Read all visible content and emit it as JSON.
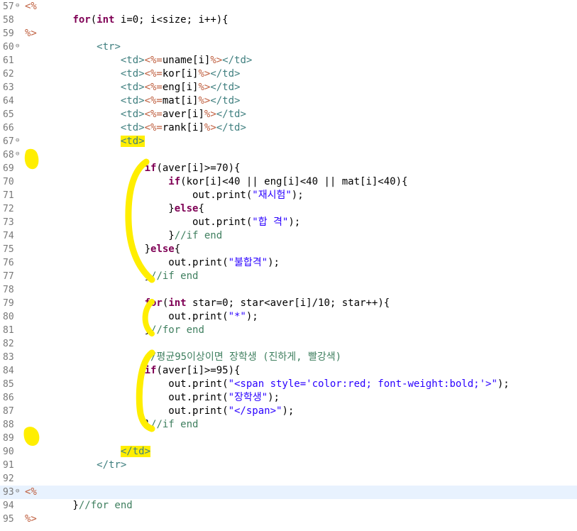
{
  "editor": {
    "lines": [
      {
        "num": "57",
        "fold": "⊖",
        "segs": [
          {
            "t": "<%",
            "c": "scr"
          }
        ]
      },
      {
        "num": "58",
        "segs": [
          {
            "t": "        "
          },
          {
            "t": "for",
            "c": "kw"
          },
          {
            "t": "("
          },
          {
            "t": "int",
            "c": "kw"
          },
          {
            "t": " i=0; i<size; i++){"
          }
        ]
      },
      {
        "num": "59",
        "segs": [
          {
            "t": "%>",
            "c": "scr"
          }
        ]
      },
      {
        "num": "60",
        "fold": "⊖",
        "segs": [
          {
            "t": "            "
          },
          {
            "t": "<tr>",
            "c": "tag"
          }
        ]
      },
      {
        "num": "61",
        "segs": [
          {
            "t": "                "
          },
          {
            "t": "<td>",
            "c": "tag"
          },
          {
            "t": "<%=",
            "c": "scr"
          },
          {
            "t": "uname[i]"
          },
          {
            "t": "%>",
            "c": "scr"
          },
          {
            "t": "</td>",
            "c": "tag"
          }
        ]
      },
      {
        "num": "62",
        "segs": [
          {
            "t": "                "
          },
          {
            "t": "<td>",
            "c": "tag"
          },
          {
            "t": "<%=",
            "c": "scr"
          },
          {
            "t": "kor[i]"
          },
          {
            "t": "%>",
            "c": "scr"
          },
          {
            "t": "</td>",
            "c": "tag"
          }
        ]
      },
      {
        "num": "63",
        "segs": [
          {
            "t": "                "
          },
          {
            "t": "<td>",
            "c": "tag"
          },
          {
            "t": "<%=",
            "c": "scr"
          },
          {
            "t": "eng[i]"
          },
          {
            "t": "%>",
            "c": "scr"
          },
          {
            "t": "</td>",
            "c": "tag"
          }
        ]
      },
      {
        "num": "64",
        "segs": [
          {
            "t": "                "
          },
          {
            "t": "<td>",
            "c": "tag"
          },
          {
            "t": "<%=",
            "c": "scr"
          },
          {
            "t": "mat[i]"
          },
          {
            "t": "%>",
            "c": "scr"
          },
          {
            "t": "</td>",
            "c": "tag"
          }
        ]
      },
      {
        "num": "65",
        "segs": [
          {
            "t": "                "
          },
          {
            "t": "<td>",
            "c": "tag"
          },
          {
            "t": "<%=",
            "c": "scr"
          },
          {
            "t": "aver[i]"
          },
          {
            "t": "%>",
            "c": "scr"
          },
          {
            "t": "</td>",
            "c": "tag"
          }
        ]
      },
      {
        "num": "66",
        "segs": [
          {
            "t": "                "
          },
          {
            "t": "<td>",
            "c": "tag"
          },
          {
            "t": "<%=",
            "c": "scr"
          },
          {
            "t": "rank[i]"
          },
          {
            "t": "%>",
            "c": "scr"
          },
          {
            "t": "</td>",
            "c": "tag"
          }
        ]
      },
      {
        "num": "67",
        "fold": "⊖",
        "segs": [
          {
            "t": "                "
          },
          {
            "t": "<td>",
            "c": "tag hl"
          }
        ]
      },
      {
        "num": "68",
        "fold": "⊖",
        "segs": [
          {
            "t": "<%",
            "c": "scr"
          }
        ]
      },
      {
        "num": "69",
        "segs": [
          {
            "t": "                    "
          },
          {
            "t": "if",
            "c": "kw"
          },
          {
            "t": "(aver[i]>=70){"
          }
        ]
      },
      {
        "num": "70",
        "segs": [
          {
            "t": "                        "
          },
          {
            "t": "if",
            "c": "kw"
          },
          {
            "t": "(kor[i]<40 || eng[i]<40 || mat[i]<40){"
          }
        ]
      },
      {
        "num": "71",
        "segs": [
          {
            "t": "                            out.print("
          },
          {
            "t": "\"재시험\"",
            "c": "str"
          },
          {
            "t": ");"
          }
        ]
      },
      {
        "num": "72",
        "segs": [
          {
            "t": "                        }"
          },
          {
            "t": "else",
            "c": "kw"
          },
          {
            "t": "{"
          }
        ]
      },
      {
        "num": "73",
        "segs": [
          {
            "t": "                            out.print("
          },
          {
            "t": "\"합 격\"",
            "c": "str"
          },
          {
            "t": ");"
          }
        ]
      },
      {
        "num": "74",
        "segs": [
          {
            "t": "                        }"
          },
          {
            "t": "//if end",
            "c": "cm"
          }
        ]
      },
      {
        "num": "75",
        "segs": [
          {
            "t": "                    }"
          },
          {
            "t": "else",
            "c": "kw"
          },
          {
            "t": "{"
          }
        ]
      },
      {
        "num": "76",
        "segs": [
          {
            "t": "                        out.print("
          },
          {
            "t": "\"불합격\"",
            "c": "str"
          },
          {
            "t": ");"
          }
        ]
      },
      {
        "num": "77",
        "segs": [
          {
            "t": "                    }"
          },
          {
            "t": "//if end",
            "c": "cm"
          }
        ]
      },
      {
        "num": "78",
        "segs": []
      },
      {
        "num": "79",
        "segs": [
          {
            "t": "                    "
          },
          {
            "t": "for",
            "c": "kw"
          },
          {
            "t": "("
          },
          {
            "t": "int",
            "c": "kw"
          },
          {
            "t": " star=0; star<aver[i]/10; star++){"
          }
        ]
      },
      {
        "num": "80",
        "segs": [
          {
            "t": "                        out.print("
          },
          {
            "t": "\"*\"",
            "c": "str"
          },
          {
            "t": ");"
          }
        ]
      },
      {
        "num": "81",
        "segs": [
          {
            "t": "                    }"
          },
          {
            "t": "//for end",
            "c": "cm"
          }
        ]
      },
      {
        "num": "82",
        "segs": []
      },
      {
        "num": "83",
        "segs": [
          {
            "t": "                    "
          },
          {
            "t": "//평균95이상이면 장학생 (진하게, 빨강색)",
            "c": "cm"
          }
        ]
      },
      {
        "num": "84",
        "segs": [
          {
            "t": "                    "
          },
          {
            "t": "if",
            "c": "kw"
          },
          {
            "t": "(aver[i]>=95){"
          }
        ]
      },
      {
        "num": "85",
        "segs": [
          {
            "t": "                        out.print("
          },
          {
            "t": "\"<span style='color:red; font-weight:bold;'>\"",
            "c": "str"
          },
          {
            "t": ");"
          }
        ]
      },
      {
        "num": "86",
        "segs": [
          {
            "t": "                        out.print("
          },
          {
            "t": "\"장학생\"",
            "c": "str"
          },
          {
            "t": ");"
          }
        ]
      },
      {
        "num": "87",
        "segs": [
          {
            "t": "                        out.print("
          },
          {
            "t": "\"</span>\"",
            "c": "str"
          },
          {
            "t": ");"
          }
        ]
      },
      {
        "num": "88",
        "segs": [
          {
            "t": "                    }"
          },
          {
            "t": "//if end",
            "c": "cm"
          }
        ]
      },
      {
        "num": "89",
        "segs": [
          {
            "t": "%>",
            "c": "scr"
          }
        ]
      },
      {
        "num": "90",
        "segs": [
          {
            "t": "                "
          },
          {
            "t": "</td>",
            "c": "tag hl"
          }
        ]
      },
      {
        "num": "91",
        "segs": [
          {
            "t": "            "
          },
          {
            "t": "</tr>",
            "c": "tag"
          }
        ]
      },
      {
        "num": "92",
        "segs": []
      },
      {
        "num": "93",
        "fold": "⊖",
        "current": true,
        "segs": [
          {
            "t": "<%",
            "c": "scr"
          }
        ]
      },
      {
        "num": "94",
        "segs": [
          {
            "t": "        }"
          },
          {
            "t": "//for end",
            "c": "cm"
          }
        ]
      },
      {
        "num": "95",
        "segs": [
          {
            "t": "%>",
            "c": "scr"
          }
        ]
      }
    ]
  },
  "colors": {
    "keyword": "#7f0055",
    "tag": "#3f7f7f",
    "scriptlet": "#bf5f3f",
    "string": "#2a00ff",
    "comment": "#3f7f5f",
    "highlight": "#ffee00",
    "current_line": "#e8f2fe"
  }
}
